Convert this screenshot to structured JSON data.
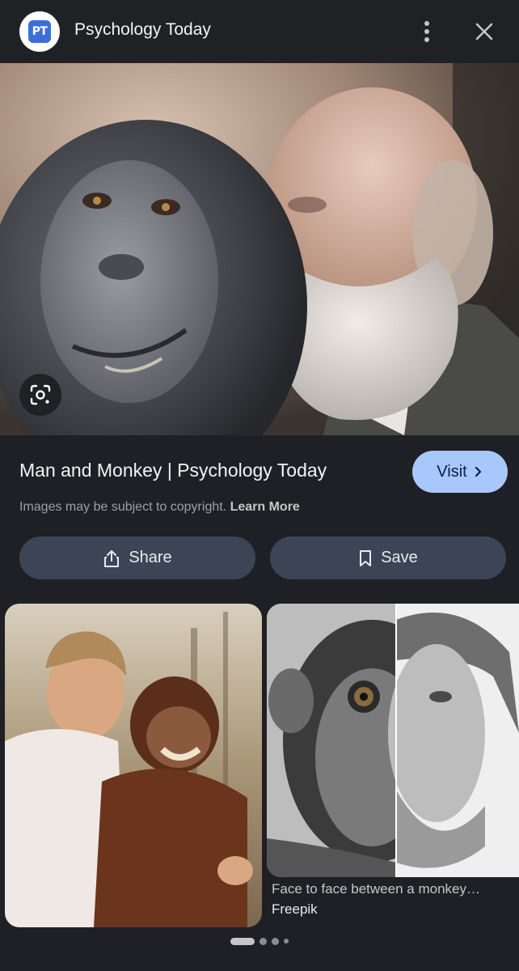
{
  "header": {
    "site_name": "Psychology Today",
    "logo_text": "PT",
    "more_icon": "more-vert-icon",
    "close_icon": "close-icon"
  },
  "result": {
    "title": "Man and Monkey | Psychology Today",
    "visit_label": "Visit",
    "copyright_text": "Images may be subject to copyright.",
    "learn_more": "Learn More",
    "share_label": "Share",
    "save_label": "Save"
  },
  "related": [
    {
      "caption": "",
      "source": ""
    },
    {
      "caption": "Face to face between a monkey…",
      "source": "Freepik"
    }
  ],
  "carousel": {
    "pages": 4,
    "active": 0
  },
  "colors": {
    "background": "#1f2025",
    "visit_button": "#a8c7fa",
    "action_button": "#3c4556",
    "logo_blue": "#3b6fd8"
  }
}
